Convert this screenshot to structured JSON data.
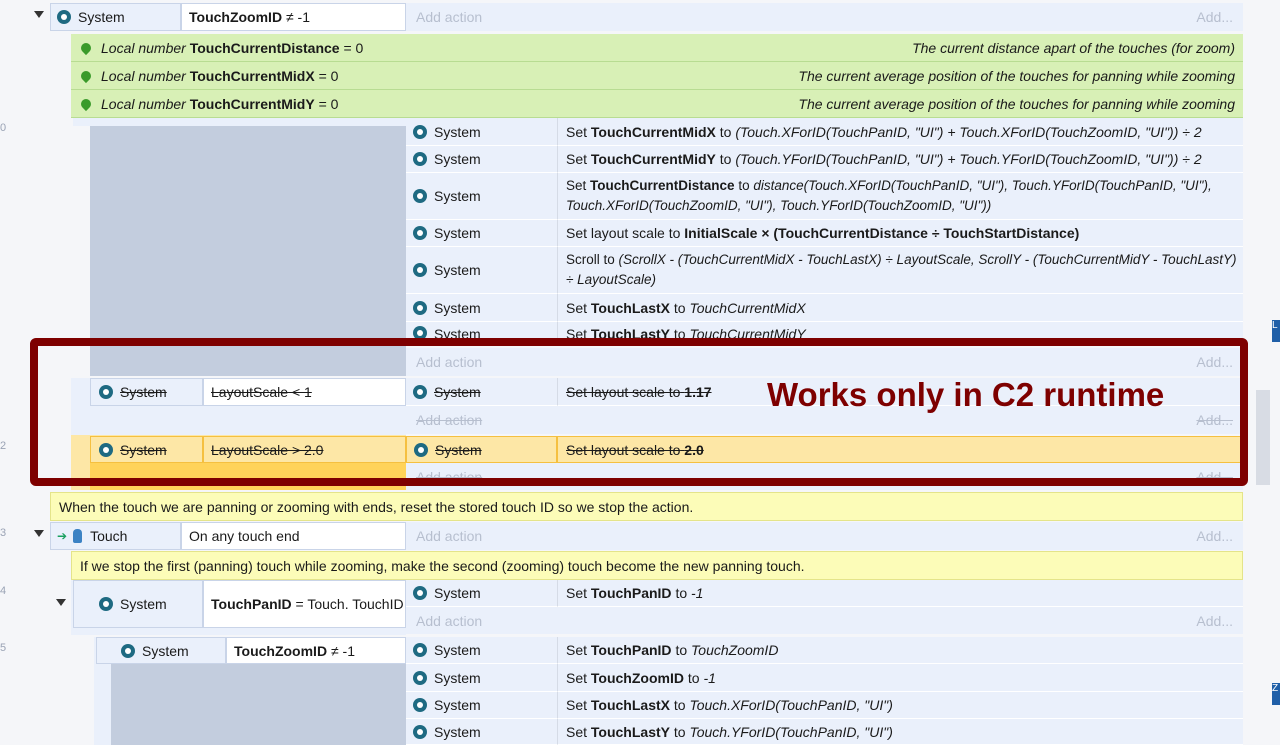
{
  "gutter_numbers": [
    "0",
    "2",
    "3",
    "4",
    "5"
  ],
  "edge_tabs": [
    "L",
    "Z"
  ],
  "add_action": "Add action",
  "add_link": "Add...",
  "rows": {
    "r1": {
      "obj": "System",
      "cond_name": "TouchZoomID",
      "cond_op": "≠ -1"
    },
    "locals": [
      {
        "prefix": "Local number",
        "name": "TouchCurrentDistance",
        "value": "= 0",
        "comment": "The current distance apart of the touches (for zoom)"
      },
      {
        "prefix": "Local number",
        "name": "TouchCurrentMidX",
        "value": "= 0",
        "comment": "The current average position of the touches for panning while zooming"
      },
      {
        "prefix": "Local number",
        "name": "TouchCurrentMidY",
        "value": "= 0",
        "comment": "The current average position of the touches for panning while zooming"
      }
    ],
    "actions1": [
      {
        "obj": "System",
        "pre": "Set",
        "name": "TouchCurrentMidX",
        "mid": "to",
        "expr": "(Touch.XForID(TouchPanID, \"UI\") + Touch.XForID(TouchZoomID, \"UI\")) ÷ 2"
      },
      {
        "obj": "System",
        "pre": "Set",
        "name": "TouchCurrentMidY",
        "mid": "to",
        "expr": "(Touch.YForID(TouchPanID, \"UI\") + Touch.YForID(TouchZoomID, \"UI\")) ÷ 2"
      },
      {
        "obj": "System",
        "pre": "Set",
        "name": "TouchCurrentDistance",
        "mid": "to",
        "expr": "distance(Touch.XForID(TouchPanID, \"UI\"), Touch.YForID(TouchPanID, \"UI\"), Touch.XForID(TouchZoomID, \"UI\"), Touch.YForID(TouchZoomID, \"UI\"))"
      },
      {
        "obj": "System",
        "pre": "Set layout scale to",
        "name": "InitialScale × (TouchCurrentDistance ÷ TouchStartDistance)",
        "mid": "",
        "expr": ""
      },
      {
        "obj": "System",
        "pre": "Scroll to",
        "name": "",
        "mid": "",
        "expr": "(ScrollX - (TouchCurrentMidX - TouchLastX) ÷ LayoutScale, ScrollY - (TouchCurrentMidY - TouchLastY) ÷ LayoutScale)"
      },
      {
        "obj": "System",
        "pre": "Set",
        "name": "TouchLastX",
        "mid": "to",
        "expr": "TouchCurrentMidX"
      },
      {
        "obj": "System",
        "pre": "Set",
        "name": "TouchLastY",
        "mid": "to",
        "expr": "TouchCurrentMidY"
      }
    ],
    "sub1": {
      "obj": "System",
      "cond": "LayoutScale < 1",
      "act_obj": "System",
      "act_pre": "Set layout scale to",
      "act_val": "1.17"
    },
    "sub2": {
      "obj": "System",
      "cond": "LayoutScale > 2.0",
      "act_obj": "System",
      "act_pre": "Set layout scale to",
      "act_val": "2.0"
    },
    "comment1": "When the touch we are panning or zooming with ends, reset the stored touch ID so we stop the action.",
    "touch_event": {
      "obj": "Touch",
      "cond": "On any touch end"
    },
    "comment2": "If we stop the first (panning) touch while zooming, make the second (zooming) touch become the new panning touch.",
    "ev3": {
      "obj": "System",
      "cond_name": "TouchPanID",
      "cond_rest": "= Touch.",
      "cond_rest2": "TouchID",
      "act_obj": "System",
      "act_pre": "Set",
      "act_name": "TouchPanID",
      "act_mid": "to",
      "act_expr": "-1"
    },
    "ev4": {
      "obj": "System",
      "cond_name": "TouchZoomID",
      "cond_op": "≠ -1"
    },
    "actions4": [
      {
        "obj": "System",
        "pre": "Set",
        "name": "TouchPanID",
        "mid": "to",
        "expr": "TouchZoomID"
      },
      {
        "obj": "System",
        "pre": "Set",
        "name": "TouchZoomID",
        "mid": "to",
        "expr": "-1"
      },
      {
        "obj": "System",
        "pre": "Set",
        "name": "TouchLastX",
        "mid": "to",
        "expr": "Touch.XForID(TouchPanID, \"UI\")"
      },
      {
        "obj": "System",
        "pre": "Set",
        "name": "TouchLastY",
        "mid": "to",
        "expr": "Touch.YForID(TouchPanID, \"UI\")"
      }
    ]
  },
  "overlay": {
    "text": "Works only in C2 runtime",
    "color": "#7e0000"
  }
}
